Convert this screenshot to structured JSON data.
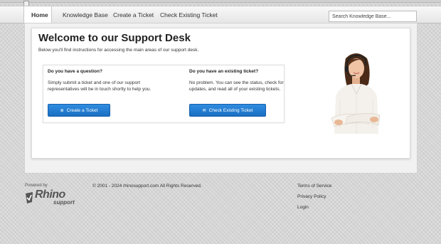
{
  "nav": {
    "tabs": [
      {
        "label": "Home",
        "active": true
      },
      {
        "label": "Knowledge Base"
      },
      {
        "label": "Create a Ticket"
      },
      {
        "label": "Check Existing Ticket"
      }
    ],
    "search_placeholder": "Search Knowledge Base..."
  },
  "main": {
    "title": "Welcome to our Support Desk",
    "intro": "Below you'll find instructions for accessing the main areas of our support desk.",
    "question": {
      "heading": "Do you have a question?",
      "text_lines": [
        "Simply submit a ticket and one of our support",
        "representatives will be in touch shortly to help you."
      ],
      "button_label": "Create a Ticket",
      "button_icon": "plus-circle-icon"
    },
    "existing": {
      "heading": "Do you have an existing ticket?",
      "text_lines": [
        "No problem. You can see the status, check for",
        "updates, and read all of your existing tickets."
      ],
      "button_label": "Check Existing Ticket",
      "button_icon": "envelope-icon"
    }
  },
  "footer": {
    "powered_by": "Powered by",
    "logo_primary": "Rhino",
    "logo_secondary": "support",
    "copyright": "© 2001 - 2024 rhinosupport.com All Rights Reserved.",
    "links": [
      "Terms of Service",
      "Privacy Policy",
      "Login"
    ]
  },
  "colors": {
    "button": "#1f78cc",
    "background": "#d8d8d8"
  }
}
